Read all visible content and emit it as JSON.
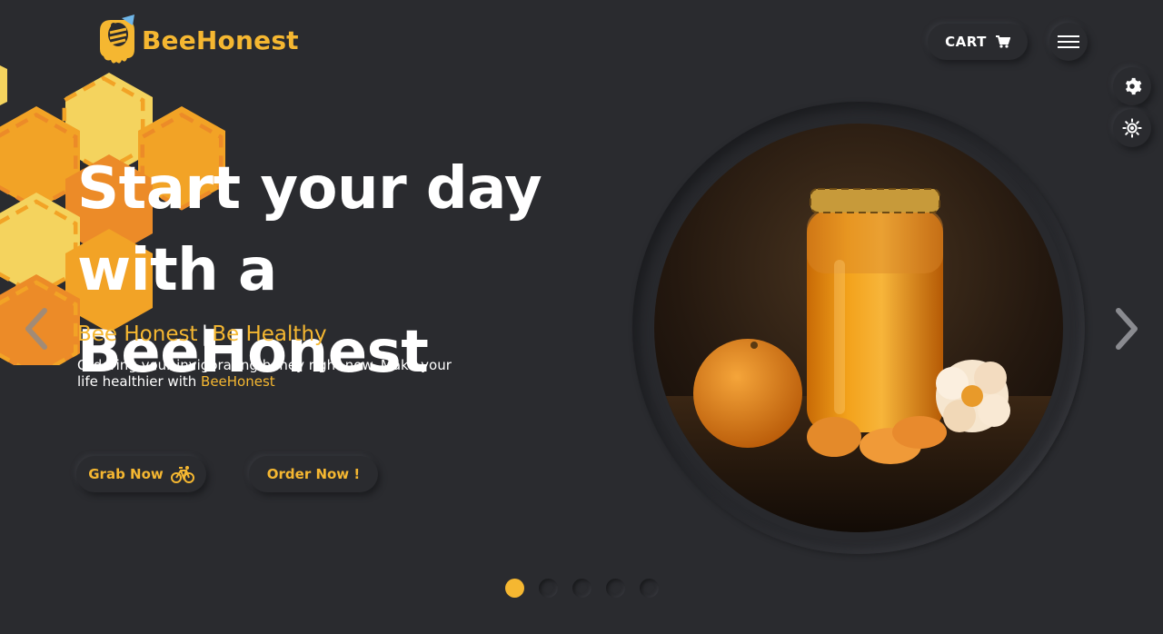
{
  "brand": {
    "name": "BeeHonest"
  },
  "header": {
    "cart_label": "CART"
  },
  "hero": {
    "headline_line1": "Start your day",
    "headline_line2": "with a BeeHonest",
    "tagline_part1": "Bee Honest",
    "tagline_sep": "|",
    "tagline_part2": "Be Healthy",
    "description": "Ordering your invigorating honey right now. Make your life healthier with",
    "description_brand": "BeeHonest",
    "grab_label": "Grab Now",
    "order_label": "Order Now !"
  },
  "icons": {
    "cart": "cart-icon",
    "menu": "hamburger-menu-icon",
    "settings": "gear-icon",
    "theme": "sun-icon",
    "grab": "bicycle-icon",
    "prev": "chevron-left-icon",
    "next": "chevron-right-icon"
  },
  "carousel": {
    "slides": 5,
    "active_index": 0
  },
  "colors": {
    "accent": "#f5b731",
    "background": "#2a2b2f",
    "honey_light": "#f4d35e",
    "honey_mid": "#f2a326",
    "honey_dark": "#ec8b28"
  }
}
